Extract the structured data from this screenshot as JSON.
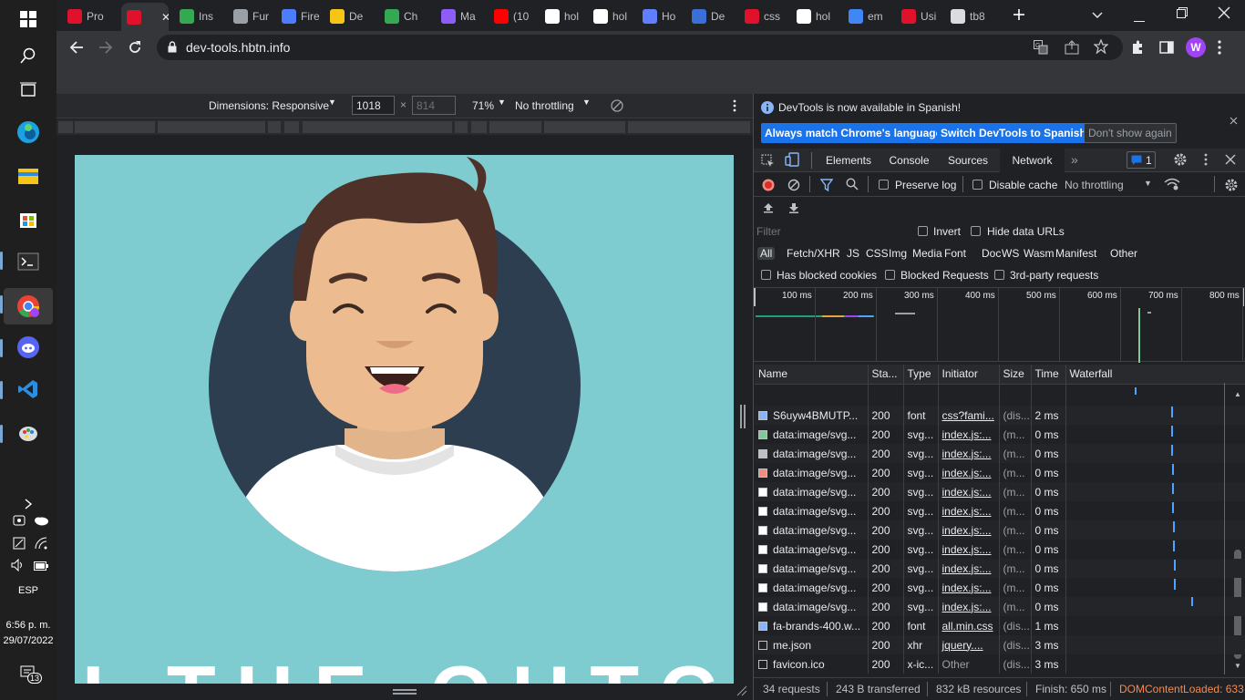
{
  "taskbar": {
    "tray": {
      "language": "ESP",
      "time": "6:56 p. m.",
      "date": "29/07/2022",
      "notifications": "13"
    },
    "colors": {
      "chrome": "#ea4335",
      "edge": "#1ba1e2",
      "discord": "#5865f2",
      "vscode": "#2d8ee0",
      "explorer": "#f5c518"
    }
  },
  "browser": {
    "tabs": [
      {
        "label": "Pro",
        "icon": "holberton-icon",
        "color": "#e0112b"
      },
      {
        "label": "",
        "icon": "holberton-icon",
        "color": "#e0112b",
        "active": true
      },
      {
        "label": "Ins",
        "icon": "chrome-icon",
        "color": "#34a853"
      },
      {
        "label": "Fur",
        "icon": "book-icon",
        "color": "#9aa0a6"
      },
      {
        "label": "Fire",
        "icon": "firefox-icon",
        "color": "#4d7cff"
      },
      {
        "label": "De",
        "icon": "udemy-icon",
        "color": "#f5c518"
      },
      {
        "label": "Ch",
        "icon": "chrome-icon",
        "color": "#34a853"
      },
      {
        "label": "Ma",
        "icon": "app-icon",
        "color": "#8e5cf7"
      },
      {
        "label": "(10",
        "icon": "youtube-icon",
        "color": "#ff0000"
      },
      {
        "label": "hol",
        "icon": "github-icon",
        "color": "#ffffff"
      },
      {
        "label": "hol",
        "icon": "github-icon",
        "color": "#ffffff"
      },
      {
        "label": "Ho",
        "icon": "code-icon",
        "color": "#5f7fff"
      },
      {
        "label": "De",
        "icon": "shield-icon",
        "color": "#3b6fd8"
      },
      {
        "label": "css",
        "icon": "holberton-icon",
        "color": "#e0112b"
      },
      {
        "label": "hol",
        "icon": "github-icon",
        "color": "#ffffff"
      },
      {
        "label": "em",
        "icon": "google-icon",
        "color": "#4285f4"
      },
      {
        "label": "Usi",
        "icon": "holberton-icon",
        "color": "#e0112b"
      },
      {
        "label": "tb8",
        "icon": "page-icon",
        "color": "#dadce0"
      }
    ],
    "url": "dev-tools.hbtn.info",
    "profile_initial": "W",
    "profile_color": "#a142f4"
  },
  "device_toolbar": {
    "dimensions": "Dimensions: Responsive",
    "width": "1018",
    "height": "814",
    "zoom": "71%",
    "throttling": "No throttling"
  },
  "page": {
    "background": "#7ecbd0",
    "bottom_text": "I THE QUTC"
  },
  "devtools": {
    "banner": {
      "message": "DevTools is now available in Spanish!",
      "btn_match": "Always match Chrome's language",
      "btn_switch": "Switch DevTools to Spanish",
      "btn_dismiss": "Don't show again"
    },
    "tabs": [
      "Elements",
      "Console",
      "Sources",
      "Network"
    ],
    "active_tab": "Network",
    "issues_count": "1",
    "network_toolbar": {
      "preserve_log": "Preserve log",
      "disable_cache": "Disable cache",
      "throttling": "No throttling"
    },
    "filter": {
      "placeholder": "Filter",
      "invert": "Invert",
      "hide_data_urls": "Hide data URLs",
      "types": [
        "All",
        "Fetch/XHR",
        "JS",
        "CSS",
        "Img",
        "Media",
        "Font",
        "Doc",
        "WS",
        "Wasm",
        "Manifest",
        "Other"
      ],
      "has_blocked_cookies": "Has blocked cookies",
      "blocked_requests": "Blocked Requests",
      "third_party": "3rd-party requests"
    },
    "timeline_ticks": [
      "100 ms",
      "200 ms",
      "300 ms",
      "400 ms",
      "500 ms",
      "600 ms",
      "700 ms",
      "800 ms"
    ],
    "columns": [
      "Name",
      "Sta...",
      "Type",
      "Initiator",
      "Size",
      "Time",
      "Waterfall"
    ],
    "rows": [
      {
        "name": "S6uyw4BMUTP...",
        "status": "200",
        "type": "font",
        "initiator": "css?fami...",
        "size": "(dis...",
        "time": "2 ms",
        "icon": "font-icon"
      },
      {
        "name": "data:image/svg...",
        "status": "200",
        "type": "svg...",
        "initiator": "index.js:...",
        "size": "(m...",
        "time": "0 ms",
        "icon": "check-image-icon"
      },
      {
        "name": "data:image/svg...",
        "status": "200",
        "type": "svg...",
        "initiator": "index.js:...",
        "size": "(m...",
        "time": "0 ms",
        "icon": "grid-image-icon"
      },
      {
        "name": "data:image/svg...",
        "status": "200",
        "type": "svg...",
        "initiator": "index.js:...",
        "size": "(m...",
        "time": "0 ms",
        "icon": "error-image-icon"
      },
      {
        "name": "data:image/svg...",
        "status": "200",
        "type": "svg...",
        "initiator": "index.js:...",
        "size": "(m...",
        "time": "0 ms",
        "icon": "image-icon"
      },
      {
        "name": "data:image/svg...",
        "status": "200",
        "type": "svg...",
        "initiator": "index.js:...",
        "size": "(m...",
        "time": "0 ms",
        "icon": "image-icon"
      },
      {
        "name": "data:image/svg...",
        "status": "200",
        "type": "svg...",
        "initiator": "index.js:...",
        "size": "(m...",
        "time": "0 ms",
        "icon": "image-icon"
      },
      {
        "name": "data:image/svg...",
        "status": "200",
        "type": "svg...",
        "initiator": "index.js:...",
        "size": "(m...",
        "time": "0 ms",
        "icon": "image-icon"
      },
      {
        "name": "data:image/svg...",
        "status": "200",
        "type": "svg...",
        "initiator": "index.js:...",
        "size": "(m...",
        "time": "0 ms",
        "icon": "image-icon"
      },
      {
        "name": "data:image/svg...",
        "status": "200",
        "type": "svg...",
        "initiator": "index.js:...",
        "size": "(m...",
        "time": "0 ms",
        "icon": "image-icon"
      },
      {
        "name": "data:image/svg...",
        "status": "200",
        "type": "svg...",
        "initiator": "index.js:...",
        "size": "(m...",
        "time": "0 ms",
        "icon": "image-icon"
      },
      {
        "name": "fa-brands-400.w...",
        "status": "200",
        "type": "font",
        "initiator": "all.min.css",
        "size": "(dis...",
        "time": "1 ms",
        "icon": "font-icon"
      },
      {
        "name": "me.json",
        "status": "200",
        "type": "xhr",
        "initiator": "jquery....",
        "size": "(dis...",
        "time": "3 ms",
        "icon": "file-icon"
      },
      {
        "name": "favicon.ico",
        "status": "200",
        "type": "x-ic...",
        "initiator": "Other",
        "size": "(dis...",
        "time": "3 ms",
        "icon": "file-icon"
      }
    ],
    "status_bar": {
      "requests": "34 requests",
      "transferred": "243 B transferred",
      "resources": "832 kB resources",
      "finish": "Finish: 650 ms",
      "dcl": "DOMContentLoaded: 633"
    },
    "colors": {
      "accent": "#1a73e8",
      "dcl": "#f28b54",
      "waterfall": "#4da3ff",
      "record": "#f28b82"
    }
  }
}
